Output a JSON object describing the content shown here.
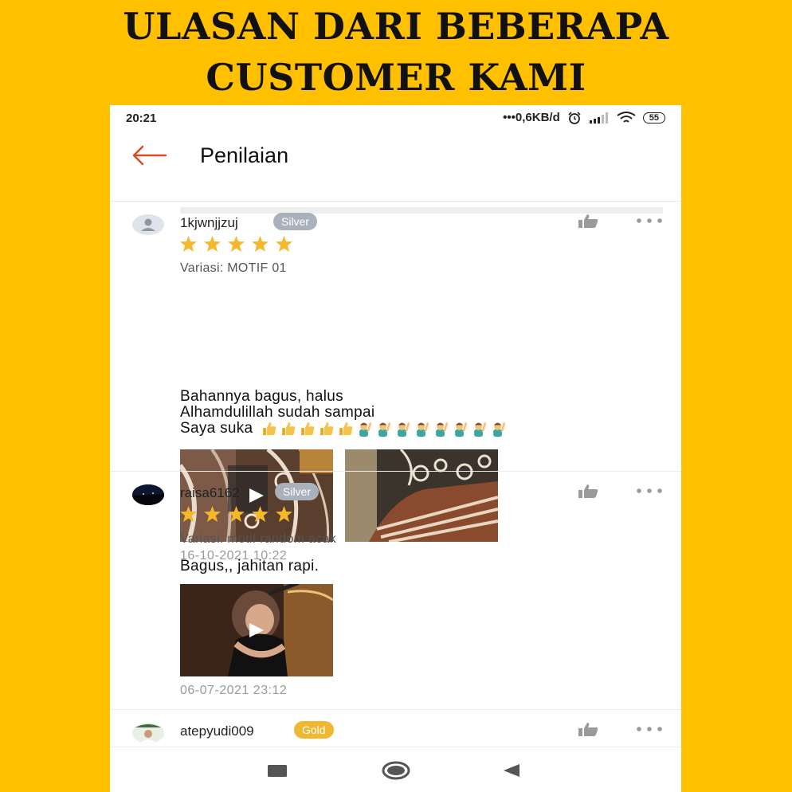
{
  "headline": {
    "line1": "ULASAN DARI BEBERAPA",
    "line2": "CUSTOMER KAMI"
  },
  "status_bar": {
    "time": "20:21",
    "network_speed": "•••0,6KB/d",
    "battery": "55"
  },
  "appbar": {
    "title": "Penilaian",
    "back_icon": "arrow-left-icon"
  },
  "colors": {
    "background": "#FFC000",
    "star": "#F6B72B",
    "back_arrow": "#E0452A",
    "badge_silver": "#A9B2BC",
    "badge_gold": "#F2B731"
  },
  "reviews": [
    {
      "username": "1kjwnjjzuj",
      "badge": "Silver",
      "rating": 5,
      "variation": "Variasi: MOTIF 01",
      "comment_lines": [
        "Bahannya bagus, halus",
        "Alhamdulillah sudah sampai",
        "Saya suka"
      ],
      "emoji": [
        "thumbs-up-icon",
        "thumbs-up-icon",
        "thumbs-up-icon",
        "thumbs-up-icon",
        "thumbs-up-icon",
        "person-raising-hand-icon",
        "person-raising-hand-icon",
        "person-raising-hand-icon",
        "person-raising-hand-icon",
        "person-raising-hand-icon",
        "person-raising-hand-icon",
        "person-raising-hand-icon",
        "person-raising-hand-icon"
      ],
      "media": [
        "video",
        "image"
      ],
      "date": "16-10-2021 10:22"
    },
    {
      "username": "raisa6162",
      "badge": "Silver",
      "rating": 5,
      "variation": "Variasi: motif random acak",
      "comment_lines": [
        "Bagus,, jahitan rapi."
      ],
      "media": [
        "video"
      ],
      "date": "06-07-2021 23:12"
    },
    {
      "username": "atepyudi009",
      "badge": "Gold"
    }
  ],
  "navbar": {
    "items": [
      "recent-apps-icon",
      "home-icon",
      "back-icon"
    ]
  }
}
